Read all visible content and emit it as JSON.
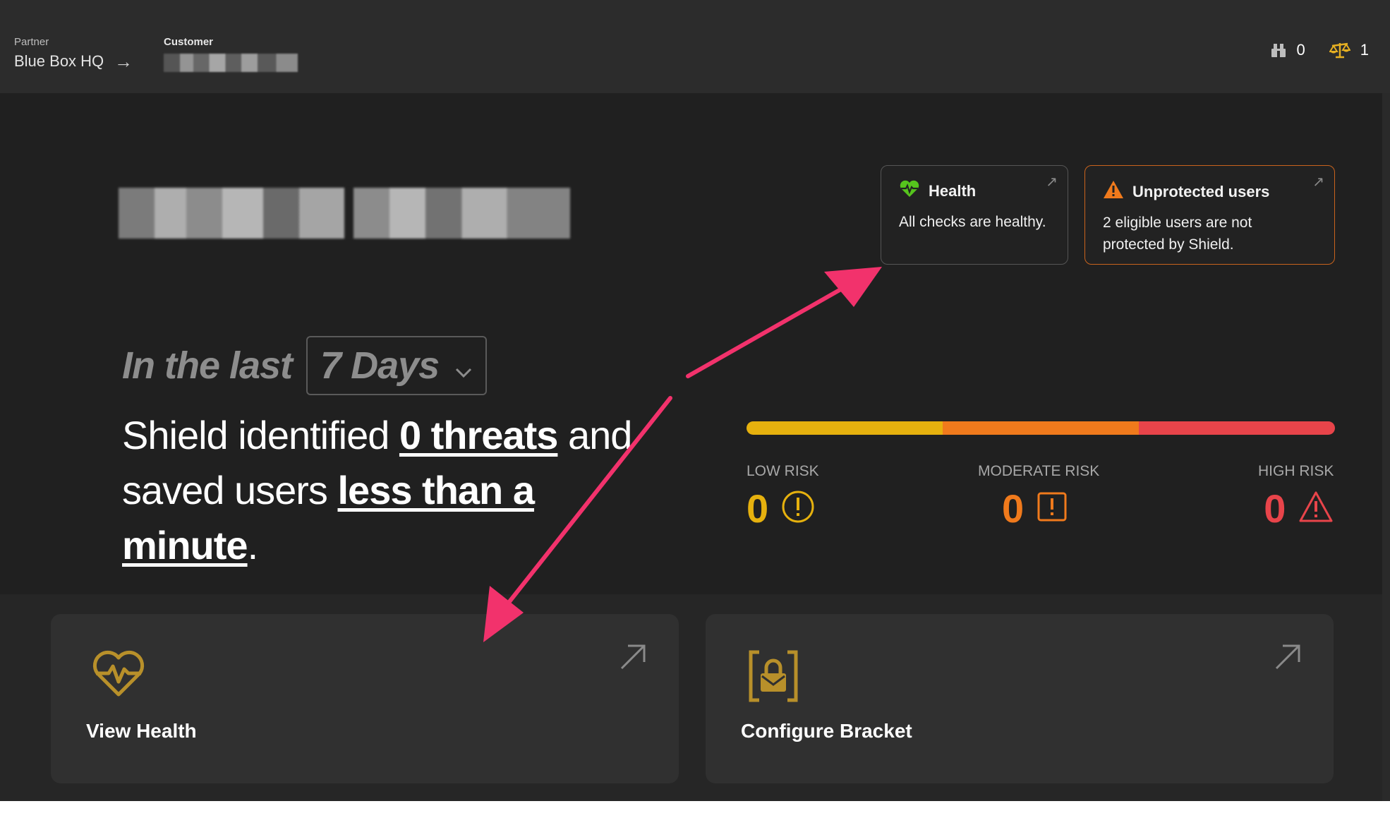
{
  "header": {
    "partner_label": "Partner",
    "partner_value": "Blue Box HQ",
    "customer_label": "Customer",
    "stats": [
      {
        "icon": "building-blocks-icon",
        "value": "0",
        "color": "#bdbdbd"
      },
      {
        "icon": "scales-icon",
        "value": "1",
        "color": "#e6b022"
      }
    ]
  },
  "status_cards": {
    "health": {
      "title": "Health",
      "text": "All checks are healthy.",
      "icon": "heartbeat-icon",
      "color": "#56c41d"
    },
    "unprotected": {
      "title": "Unprotected users",
      "text": "2 eligible users are not protected by Shield.",
      "icon": "warning-triangle-icon",
      "color": "#f07a1c"
    }
  },
  "period": {
    "prefix": "In the last",
    "selected": "7 Days"
  },
  "summary": {
    "part1": "Shield identified ",
    "threats": "0 threats",
    "part2": " and saved users ",
    "time_saved": "less than a minute",
    "part3": "."
  },
  "risk": {
    "colors": [
      "#e6b10e",
      "#f07a1c",
      "#e8444a"
    ],
    "levels": [
      {
        "label": "LOW RISK",
        "value": "0",
        "color": "#e6b10e",
        "icon": "info-circle-icon"
      },
      {
        "label": "MODERATE RISK",
        "value": "0",
        "color": "#f07a1c",
        "icon": "alert-square-icon"
      },
      {
        "label": "HIGH RISK",
        "value": "0",
        "color": "#e8444a",
        "icon": "warning-triangle-icon"
      }
    ]
  },
  "actions": [
    {
      "label": "View Health",
      "icon": "heart-pulse-icon",
      "color": "#b8902a"
    },
    {
      "label": "Configure Bracket",
      "icon": "lock-frame-icon",
      "color": "#b8902a"
    }
  ],
  "annotation_color": "#f2326c"
}
